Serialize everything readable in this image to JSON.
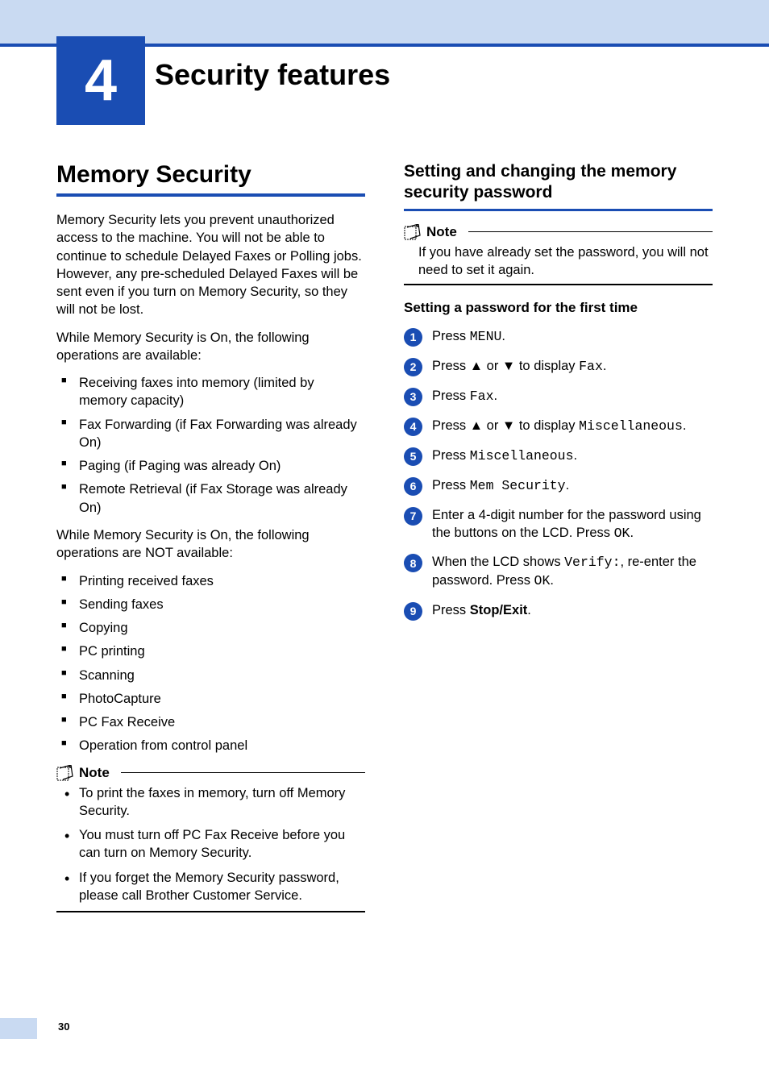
{
  "chapter": {
    "number": "4",
    "title": "Security features"
  },
  "page_number": "30",
  "left": {
    "heading": "Memory Security",
    "intro": "Memory Security lets you prevent unauthorized access to the machine. You will not be able to continue to schedule Delayed Faxes or Polling jobs. However, any pre-scheduled Delayed Faxes will be sent even if you turn on Memory Security, so they will not be lost.",
    "available_intro": "While Memory Security is On, the following operations are available:",
    "available": [
      "Receiving faxes into memory (limited by memory capacity)",
      "Fax Forwarding (if Fax Forwarding was already On)",
      "Paging (if Paging was already On)",
      "Remote Retrieval (if Fax Storage was already On)"
    ],
    "not_available_intro": "While Memory Security is On, the following operations are NOT available:",
    "not_available": [
      "Printing received faxes",
      "Sending faxes",
      "Copying",
      "PC printing",
      "Scanning",
      "PhotoCapture",
      "PC Fax Receive",
      "Operation from control panel"
    ],
    "note_title": "Note",
    "note_items": [
      "To print the faxes in memory, turn off Memory Security.",
      "You must turn off PC Fax Receive before you can turn on Memory Security.",
      "If you forget the Memory Security password, please call Brother Customer Service."
    ]
  },
  "right": {
    "heading": "Setting and changing the memory security password",
    "note_title": "Note",
    "note_body": "If you have already set the password, you will not need to set it again.",
    "subheading": "Setting a password for the first time",
    "steps": {
      "s1_a": "Press ",
      "s1_m": "MENU",
      "s1_b": ".",
      "s2_a": "Press ▲ or ▼ to display ",
      "s2_m": "Fax",
      "s2_b": ".",
      "s3_a": "Press ",
      "s3_m": "Fax",
      "s3_b": ".",
      "s4_a": "Press ▲ or ▼ to display ",
      "s4_m": "Miscellaneous",
      "s4_b": ".",
      "s5_a": "Press ",
      "s5_m": "Miscellaneous",
      "s5_b": ".",
      "s6_a": "Press ",
      "s6_m": "Mem Security",
      "s6_b": ".",
      "s7_a": "Enter a 4-digit number for the password using the buttons on the LCD. Press ",
      "s7_m": "OK",
      "s7_b": ".",
      "s8_a": "When the LCD shows ",
      "s8_m": "Verify:",
      "s8_b": ", re-enter the password. Press ",
      "s8_m2": "OK",
      "s8_c": ".",
      "s9_a": "Press ",
      "s9_bold": "Stop/Exit",
      "s9_b": "."
    }
  }
}
